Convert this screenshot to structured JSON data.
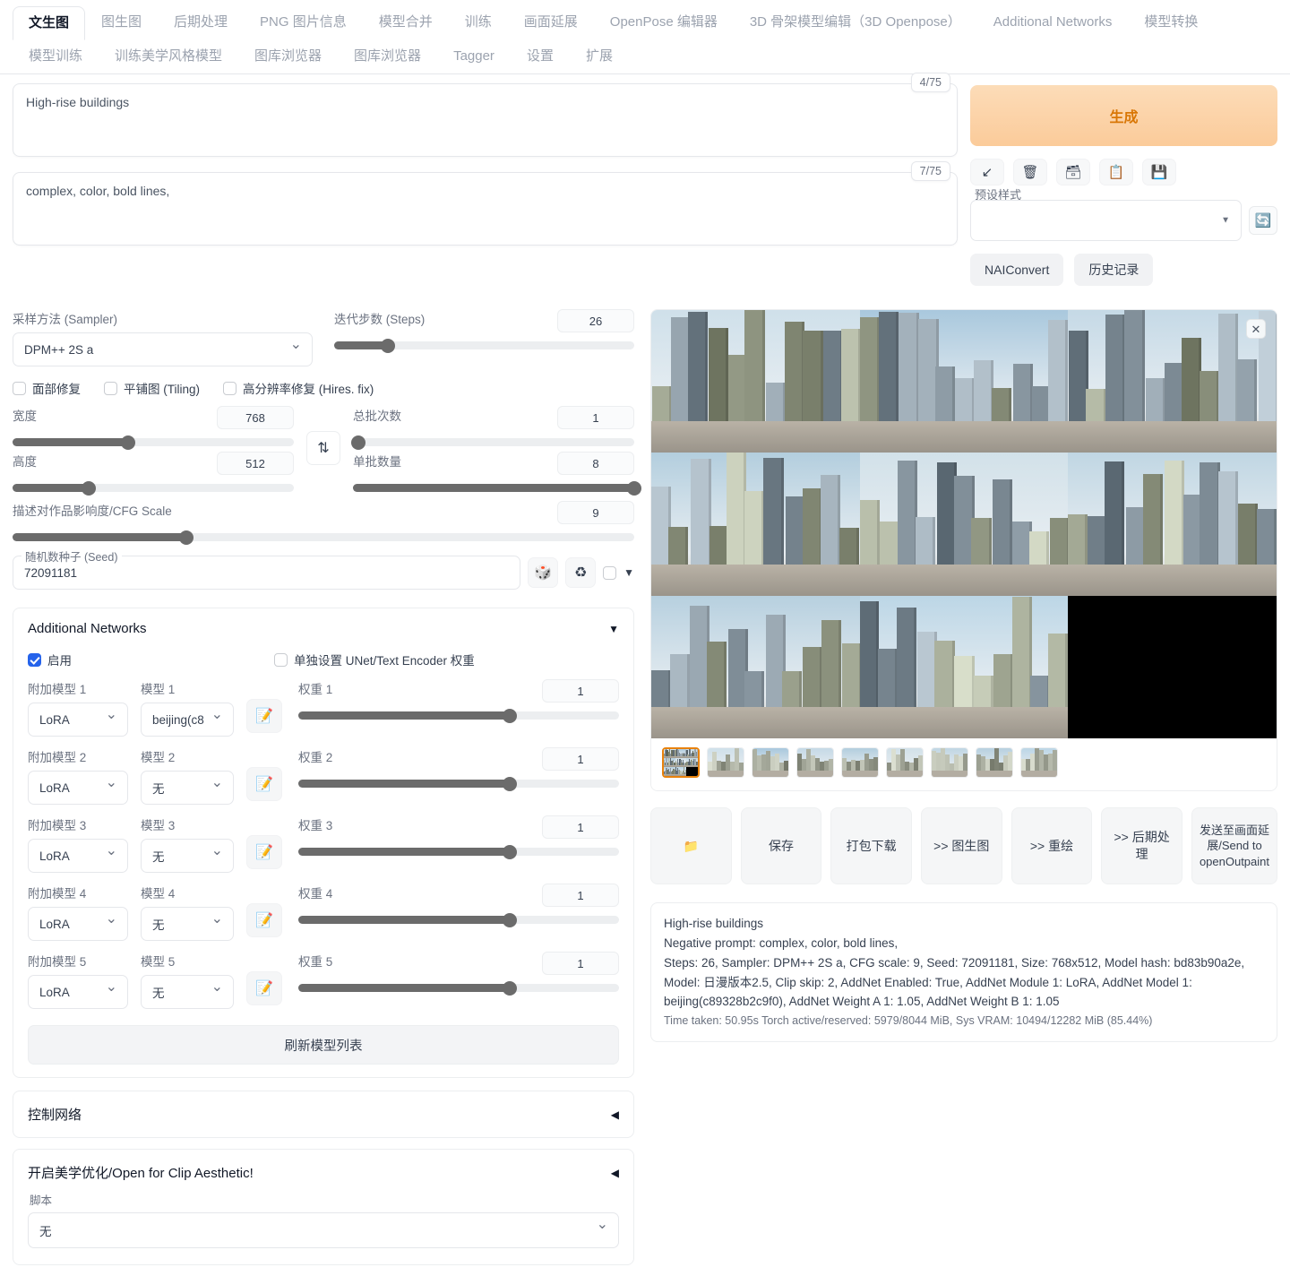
{
  "tabs": {
    "row1": [
      {
        "label": "文生图",
        "active": true
      },
      {
        "label": "图生图",
        "active": false
      },
      {
        "label": "后期处理",
        "active": false
      },
      {
        "label": "PNG 图片信息",
        "active": false
      },
      {
        "label": "模型合并",
        "active": false
      },
      {
        "label": "训练",
        "active": false
      },
      {
        "label": "画面延展",
        "active": false
      },
      {
        "label": "OpenPose 编辑器",
        "active": false
      },
      {
        "label": "3D 骨架模型编辑（3D Openpose）",
        "active": false
      },
      {
        "label": "Additional Networks",
        "active": false
      },
      {
        "label": "模型转换",
        "active": false
      }
    ],
    "row2": [
      {
        "label": "模型训练",
        "active": false
      },
      {
        "label": "训练美学风格模型",
        "active": false
      },
      {
        "label": "图库浏览器",
        "active": false
      },
      {
        "label": "图库浏览器",
        "active": false
      },
      {
        "label": "Tagger",
        "active": false
      },
      {
        "label": "设置",
        "active": false
      },
      {
        "label": "扩展",
        "active": false
      }
    ]
  },
  "prompt": {
    "positive_value": "High-rise buildings",
    "positive_counter": "4/75",
    "negative_value": "complex, color, bold lines,",
    "negative_counter": "7/75"
  },
  "generate": {
    "label": "生成",
    "icons": [
      {
        "name": "arrow-down-left-icon",
        "glyph": "↙"
      },
      {
        "name": "trash-icon",
        "glyph": "🗑"
      },
      {
        "name": "card-file-box-icon",
        "glyph": "🗃"
      },
      {
        "name": "clipboard-icon",
        "glyph": "📋"
      },
      {
        "name": "floppy-disk-icon",
        "glyph": "💾"
      }
    ],
    "styles_label": "预设样式",
    "styles_value": "",
    "refresh_icon": "🔄",
    "nai_convert": "NAIConvert",
    "history": "历史记录"
  },
  "settings": {
    "sampler_label": "采样方法 (Sampler)",
    "sampler_value": "DPM++ 2S a",
    "steps_label": "迭代步数 (Steps)",
    "steps_value": "26",
    "steps_pct": 18,
    "checkboxes": [
      {
        "label": "面部修复",
        "checked": false
      },
      {
        "label": "平铺图 (Tiling)",
        "checked": false
      },
      {
        "label": "高分辨率修复 (Hires. fix)",
        "checked": false
      }
    ],
    "width_label": "宽度",
    "width_value": "768",
    "width_pct": 41,
    "height_label": "高度",
    "height_value": "512",
    "height_pct": 27,
    "swap_icon": "⇅",
    "batch_count_label": "总批次数",
    "batch_count_value": "1",
    "batch_count_pct": 2,
    "batch_size_label": "单批数量",
    "batch_size_value": "8",
    "batch_size_pct": 100,
    "cfg_label": "描述对作品影响度/CFG Scale",
    "cfg_value": "9",
    "cfg_pct": 28,
    "seed_label": "随机数种子 (Seed)",
    "seed_value": "72091181",
    "dice_icon": "🎲",
    "recycle_icon": "♻",
    "extra_caret": "▼"
  },
  "additional_networks": {
    "title": "Additional Networks",
    "collapse_arrow": "▼",
    "enable_label": "启用",
    "enable_checked": true,
    "separate_label": "单独设置 UNet/Text Encoder 权重",
    "separate_checked": false,
    "col_module_prefix": "附加模型",
    "col_model_prefix": "模型",
    "col_weight_prefix": "权重",
    "edit_icon": "📝",
    "rows": [
      {
        "index": "1",
        "module": "LoRA",
        "model": "beijing(c8",
        "weight": "1",
        "weight_pct": 66
      },
      {
        "index": "2",
        "module": "LoRA",
        "model": "无",
        "weight": "1",
        "weight_pct": 66
      },
      {
        "index": "3",
        "module": "LoRA",
        "model": "无",
        "weight": "1",
        "weight_pct": 66
      },
      {
        "index": "4",
        "module": "LoRA",
        "model": "无",
        "weight": "1",
        "weight_pct": 66
      },
      {
        "index": "5",
        "module": "LoRA",
        "model": "无",
        "weight": "1",
        "weight_pct": 66
      }
    ],
    "refresh_models_label": "刷新模型列表"
  },
  "accordions": [
    {
      "title": "控制网络",
      "arrow": "◀"
    },
    {
      "title": "开启美学优化/Open for Clip Aesthetic!",
      "arrow": "◀"
    }
  ],
  "script": {
    "label": "脚本",
    "value": "无"
  },
  "gallery": {
    "close_icon": "✕",
    "selected_thumb_index": 0,
    "thumb_count": 9,
    "actions": [
      {
        "name": "open-folder-button",
        "label": "📁"
      },
      {
        "name": "save-button",
        "label": "保存"
      },
      {
        "name": "zip-download-button",
        "label": "打包下载"
      },
      {
        "name": "send-to-img2img-button",
        "label": ">> 图生图"
      },
      {
        "name": "send-to-inpaint-button",
        "label": ">> 重绘"
      },
      {
        "name": "send-to-extras-button",
        "label": ">> 后期处理"
      },
      {
        "name": "send-to-openoutpaint-button",
        "label": "发送至画面延展/Send to openOutpaint"
      }
    ]
  },
  "gen_info": {
    "line1": "High-rise buildings",
    "line2": "Negative prompt: complex, color, bold lines,",
    "line3": "Steps: 26, Sampler: DPM++ 2S a, CFG scale: 9, Seed: 72091181, Size: 768x512, Model hash: bd83b90a2e, Model: 日漫版本2.5, Clip skip: 2, AddNet Enabled: True, AddNet Module 1: LoRA, AddNet Model 1: beijing(c89328b2c9f0), AddNet Weight A 1: 1.05, AddNet Weight B 1: 1.05",
    "line4": "Time taken: 50.95s  Torch active/reserved: 5979/8044 MiB, Sys VRAM: 10494/12282 MiB (85.44%)"
  },
  "colors": {
    "accent_orange": "#d97706",
    "generate_bg": "#fbcb9a",
    "checkbox_blue": "#2563eb",
    "thumb_selected_border": "#e8820c"
  }
}
